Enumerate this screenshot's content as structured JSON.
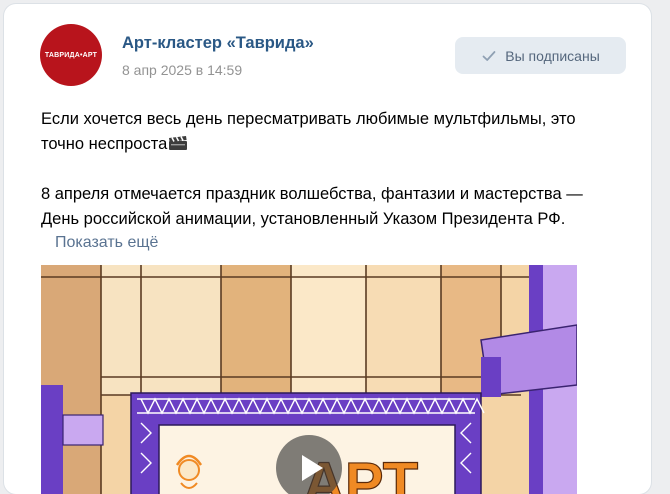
{
  "post": {
    "avatar_text": "ТАВРИДА•АРТ",
    "author": "Арт-кластер «Таврида»",
    "date": "8 апр 2025 в 14:59",
    "subscribe_label": "Вы подписаны",
    "text_line1": "Если хочется весь день пересматривать любимые мультфильмы, это",
    "text_line2": "точно неспроста",
    "text_line3": "8 апреля отмечается праздник волшебства, фантазии и мастерства —",
    "text_line4": "День российской анимации, установленный Указом Президента РФ.",
    "show_more_label": "Показать ещё"
  },
  "media": {
    "type": "video",
    "sign_text": "АРТ"
  },
  "colors": {
    "author_link": "#2a5885",
    "date_gray": "#939393",
    "button_bg": "#e5ebf1",
    "avatar_red": "#b8141c",
    "frame_purple": "#6a3fc4",
    "sign_orange": "#f08a24"
  },
  "icons": {
    "subscribe": "check-icon",
    "emoji": "clapper-board-icon",
    "video": "play-icon"
  }
}
